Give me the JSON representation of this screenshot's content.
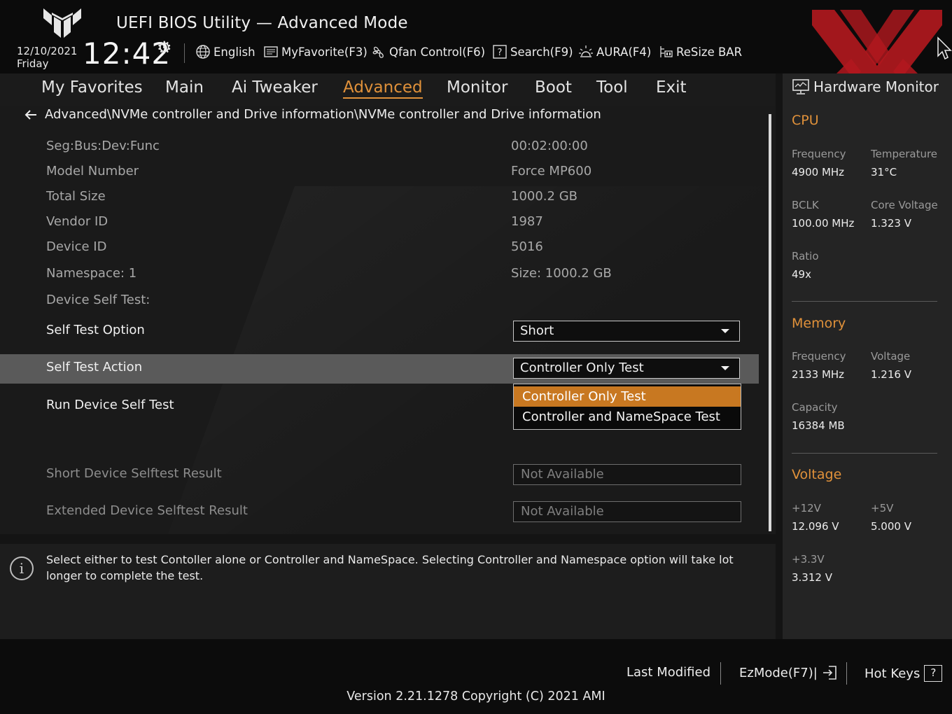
{
  "header": {
    "app_title": "UEFI BIOS Utility — Advanced Mode",
    "date": "12/10/2021",
    "day": "Friday",
    "time": "12:42",
    "tools": [
      {
        "label": "English",
        "icon": "globe-icon"
      },
      {
        "label": "MyFavorite(F3)",
        "icon": "favorite-list-icon"
      },
      {
        "label": "Qfan Control(F6)",
        "icon": "fan-icon"
      },
      {
        "label": "Search(F9)",
        "icon": "search-help-icon"
      },
      {
        "label": "AURA(F4)",
        "icon": "aura-light-icon"
      },
      {
        "label": "ReSize BAR",
        "icon": "resize-bar-icon"
      }
    ]
  },
  "tabs": [
    {
      "label": "My Favorites"
    },
    {
      "label": "Main"
    },
    {
      "label": "Ai Tweaker"
    },
    {
      "label": "Advanced",
      "active": true
    },
    {
      "label": "Monitor"
    },
    {
      "label": "Boot"
    },
    {
      "label": "Tool"
    },
    {
      "label": "Exit"
    }
  ],
  "breadcrumb": "Advanced\\NVMe controller and Drive information\\NVMe controller and Drive information",
  "info_rows": [
    {
      "label": "Seg:Bus:Dev:Func",
      "value": "00:02:00:00"
    },
    {
      "label": "Model Number",
      "value": "Force MP600"
    },
    {
      "label": "Total Size",
      "value": "1000.2 GB"
    },
    {
      "label": "Vendor ID",
      "value": "1987"
    },
    {
      "label": "Device ID",
      "value": "5016"
    },
    {
      "label": "Namespace: 1",
      "value": "Size: 1000.2 GB"
    }
  ],
  "device_self_test_label": "Device Self Test:",
  "self_test_option": {
    "label": "Self Test Option",
    "value": "Short"
  },
  "self_test_action": {
    "label": "Self Test Action",
    "value": "Controller Only Test",
    "options": [
      "Controller Only Test",
      "Controller and NameSpace Test"
    ],
    "selected_index": 0
  },
  "run_device_self_test": "Run Device Self Test",
  "results": [
    {
      "label": "Short Device Selftest Result",
      "value": "Not Available"
    },
    {
      "label": "Extended Device Selftest Result",
      "value": "Not Available"
    }
  ],
  "help_text": "Select either to test Contoller alone or Controller and NameSpace. Selecting Controller and Namespace option will take lot longer to complete the test.",
  "hardware_monitor": {
    "title": "Hardware Monitor",
    "cpu": {
      "title": "CPU",
      "frequency_label": "Frequency",
      "frequency": "4900 MHz",
      "temperature_label": "Temperature",
      "temperature": "31°C",
      "bclk_label": "BCLK",
      "bclk": "100.00 MHz",
      "core_voltage_label": "Core Voltage",
      "core_voltage": "1.323 V",
      "ratio_label": "Ratio",
      "ratio": "49x"
    },
    "memory": {
      "title": "Memory",
      "frequency_label": "Frequency",
      "frequency": "2133 MHz",
      "voltage_label": "Voltage",
      "voltage": "1.216 V",
      "capacity_label": "Capacity",
      "capacity": "16384 MB"
    },
    "voltage": {
      "title": "Voltage",
      "v12_label": "+12V",
      "v12": "12.096 V",
      "v5_label": "+5V",
      "v5": "5.000 V",
      "v33_label": "+3.3V",
      "v33": "3.312 V"
    }
  },
  "footer": {
    "last_modified": "Last Modified",
    "ezmode": "EzMode(F7)|",
    "hot_keys": "Hot Keys",
    "hot_keys_glyph": "?",
    "version": "Version 2.21.1278 Copyright (C) 2021 AMI"
  },
  "colors": {
    "accent": "#e0913a",
    "selection": "#c87821",
    "watermark": "#b3181e"
  }
}
